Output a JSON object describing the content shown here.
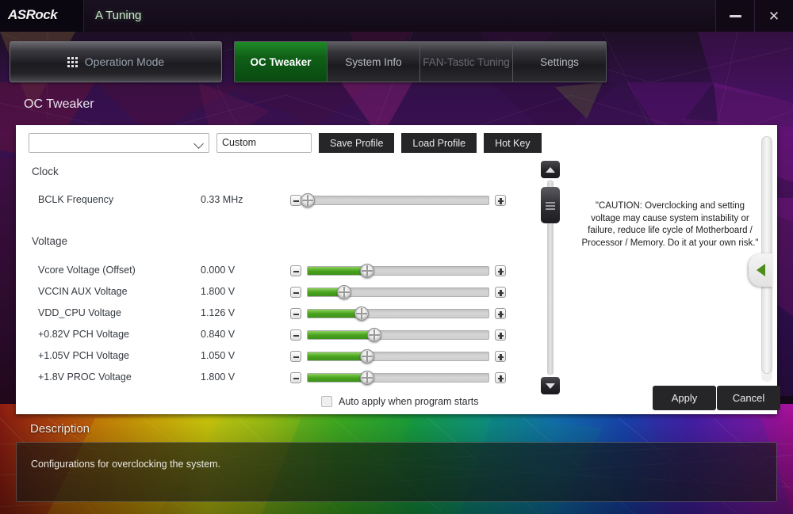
{
  "titlebar": {
    "brand": "ASRock",
    "app_title": "A Tuning",
    "minimize_label": "–",
    "close_label": "✕"
  },
  "nav": {
    "operation_mode": "Operation Mode",
    "tabs": [
      {
        "label": "OC Tweaker",
        "state": "active"
      },
      {
        "label": "System Info",
        "state": "normal"
      },
      {
        "label": "FAN-Tastic Tuning",
        "state": "disabled"
      },
      {
        "label": "Settings",
        "state": "normal"
      }
    ]
  },
  "page": {
    "title": "OC Tweaker"
  },
  "toolbar": {
    "profile_select_value": "",
    "profile_name_value": "Custom",
    "save_profile": "Save Profile",
    "load_profile": "Load Profile",
    "hot_key": "Hot Key"
  },
  "sections": [
    {
      "heading": "Clock"
    },
    {
      "heading": "Voltage"
    }
  ],
  "rows": [
    {
      "label": "BCLK Frequency",
      "value": "0.33 MHz",
      "percent": 0
    },
    {
      "label": "Vcore Voltage (Offset)",
      "value": "0.000 V",
      "percent": 33
    },
    {
      "label": "VCCIN AUX Voltage",
      "value": "1.800 V",
      "percent": 20
    },
    {
      "label": "VDD_CPU Voltage",
      "value": "1.126 V",
      "percent": 30
    },
    {
      "label": "+0.82V PCH Voltage",
      "value": "0.840 V",
      "percent": 37
    },
    {
      "label": "+1.05V PCH Voltage",
      "value": "1.050 V",
      "percent": 33
    },
    {
      "label": "+1.8V PROC Voltage",
      "value": "1.800 V",
      "percent": 33
    }
  ],
  "caution": {
    "text": "\"CAUTION: Overclocking and setting voltage may cause system instability or failure, reduce life cycle of Motherboard / Processor / Memory. Do it at your own risk.\""
  },
  "actions": {
    "apply": "Apply",
    "cancel": "Cancel",
    "auto_apply_label": "Auto apply when program starts",
    "auto_apply_checked": false
  },
  "description": {
    "title": "Description",
    "text": "Configurations for overclocking the system."
  },
  "colors": {
    "accent_green": "#0f5e17",
    "slider_fill": "#4aa41f",
    "button_dark": "#262629",
    "card_bg": "#ffffff"
  }
}
